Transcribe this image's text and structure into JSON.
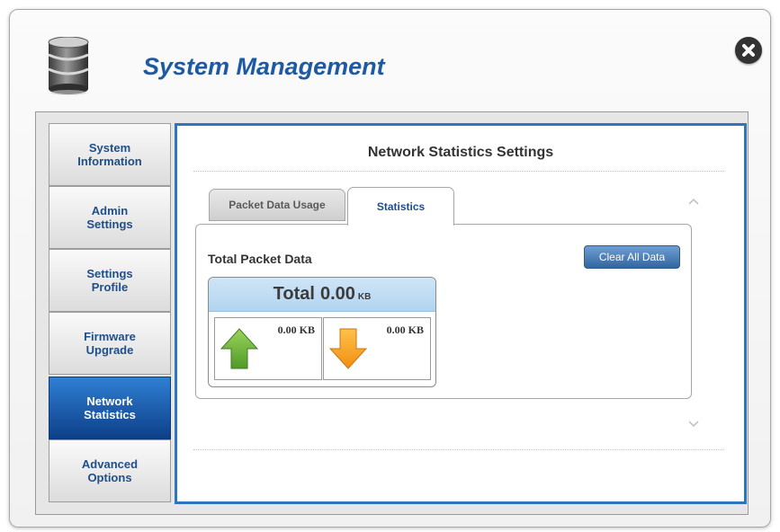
{
  "dialog": {
    "title": "System Management",
    "icon": "database-icon",
    "close_icon": "close-icon"
  },
  "sidebar": {
    "items": [
      {
        "label": "System\nInformation",
        "active": false
      },
      {
        "label": "Admin\nSettings",
        "active": false
      },
      {
        "label": "Settings\nProfile",
        "active": false
      },
      {
        "label": "Firmware\nUpgrade",
        "active": false
      },
      {
        "label": "Network\nStatistics",
        "active": true
      },
      {
        "label": "Advanced\nOptions",
        "active": false
      }
    ]
  },
  "content": {
    "title": "Network Statistics Settings",
    "tabs": [
      {
        "label": "Packet Data Usage",
        "active": false
      },
      {
        "label": "Statistics",
        "active": true
      }
    ],
    "section_label": "Total Packet Data",
    "clear_button": "Clear All Data",
    "total": {
      "label": "Total",
      "value": "0.00",
      "unit": "KB"
    },
    "upload": {
      "value": "0.00 KB",
      "icon": "upload-arrow-icon"
    },
    "download": {
      "value": "0.00 KB",
      "icon": "download-arrow-icon"
    }
  },
  "colors": {
    "accent": "#1e5aa3",
    "active_nav": "#0d3f88",
    "content_border": "#2f74bf",
    "upload_arrow": "#6fb43a",
    "download_arrow": "#f5a623"
  }
}
